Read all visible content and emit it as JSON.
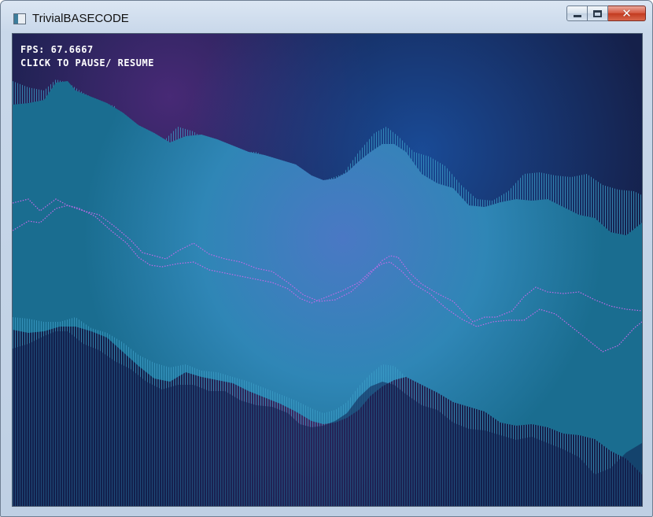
{
  "window": {
    "title": "TrivialBASECODE",
    "minimize_icon": "minimize-icon",
    "maximize_icon": "maximize-icon",
    "close_icon": "close-icon",
    "close_glyph": "✕"
  },
  "hud": {
    "fps_text": "FPS: 67.6667",
    "instruction_text": "CLICK TO PAUSE/ RESUME"
  },
  "colors": {
    "background_deep": "#17204a",
    "band_fill": "#1d7fb0",
    "trace_purple": "#c26be8",
    "trace_white": "#ffffff"
  }
}
